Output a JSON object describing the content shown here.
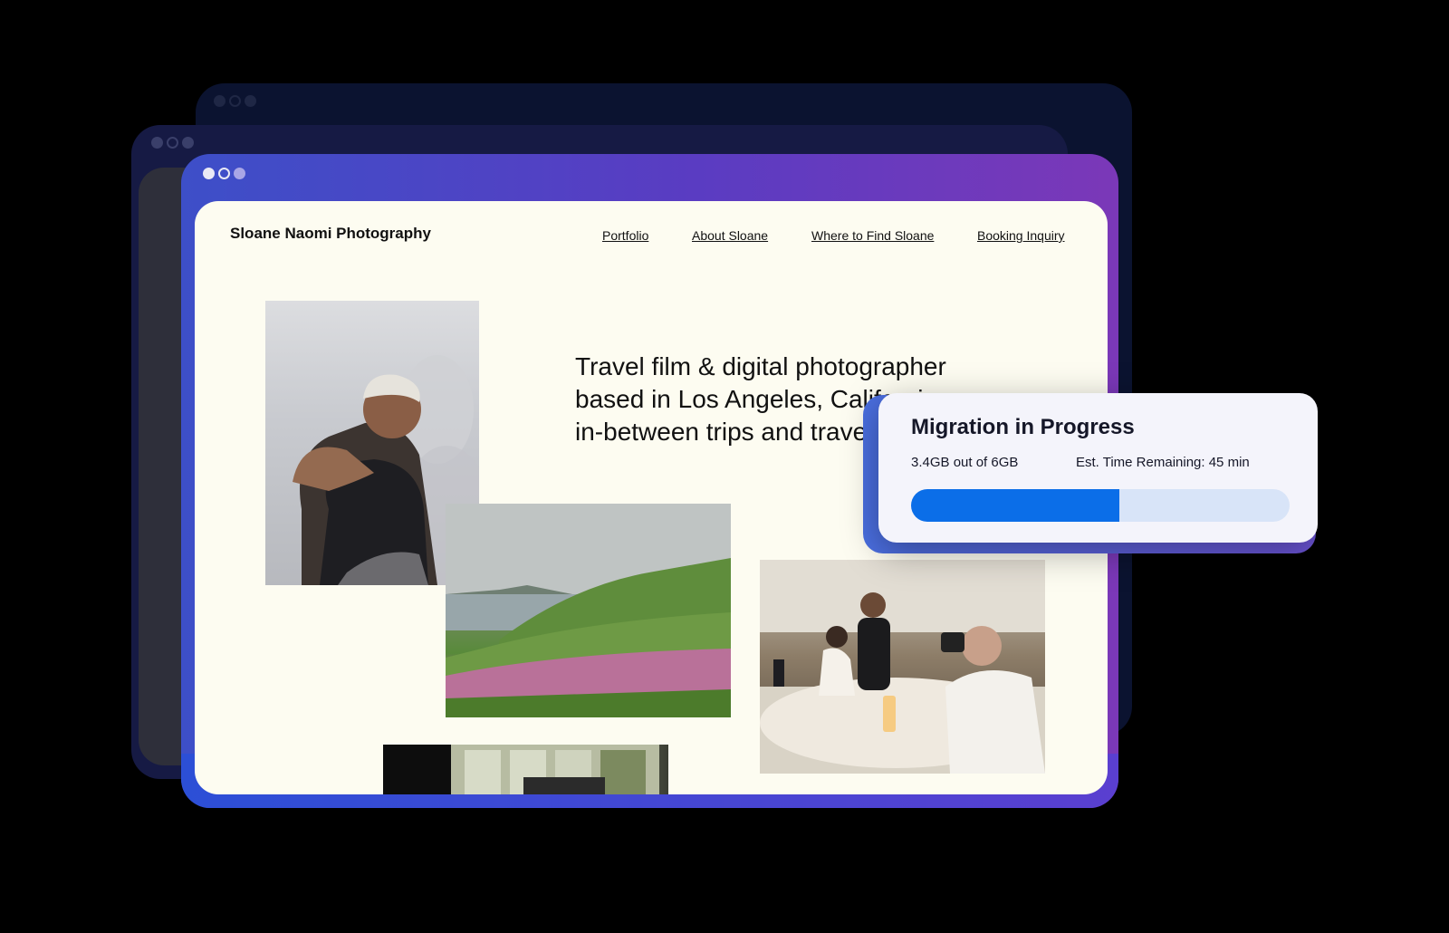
{
  "site": {
    "brand": "Sloane Naomi Photography",
    "nav": [
      {
        "label": "Portfolio"
      },
      {
        "label": "About Sloane"
      },
      {
        "label": "Where to Find Sloane"
      },
      {
        "label": "Booking Inquiry"
      }
    ],
    "hero_lines": [
      "Travel film & digital photographer",
      "based in Los Angeles, California,",
      "in-between trips and travels."
    ]
  },
  "migration": {
    "title": "Migration in Progress",
    "transferred": "3.4GB out of 6GB",
    "time_remaining": "Est. Time Remaining: 45 min",
    "progress_fraction": 0.55
  },
  "photos": [
    {
      "name": "portrait-photo"
    },
    {
      "name": "wildflower-coast-photo"
    },
    {
      "name": "wedding-photo"
    },
    {
      "name": "window-interior-photo"
    }
  ],
  "colors": {
    "progress_fill": "#0b6ee8",
    "progress_track": "#d8e4f8",
    "page_background": "#fdfcf1",
    "window_gradient_start": "#3d4fc8",
    "window_gradient_end": "#7b38b8"
  }
}
